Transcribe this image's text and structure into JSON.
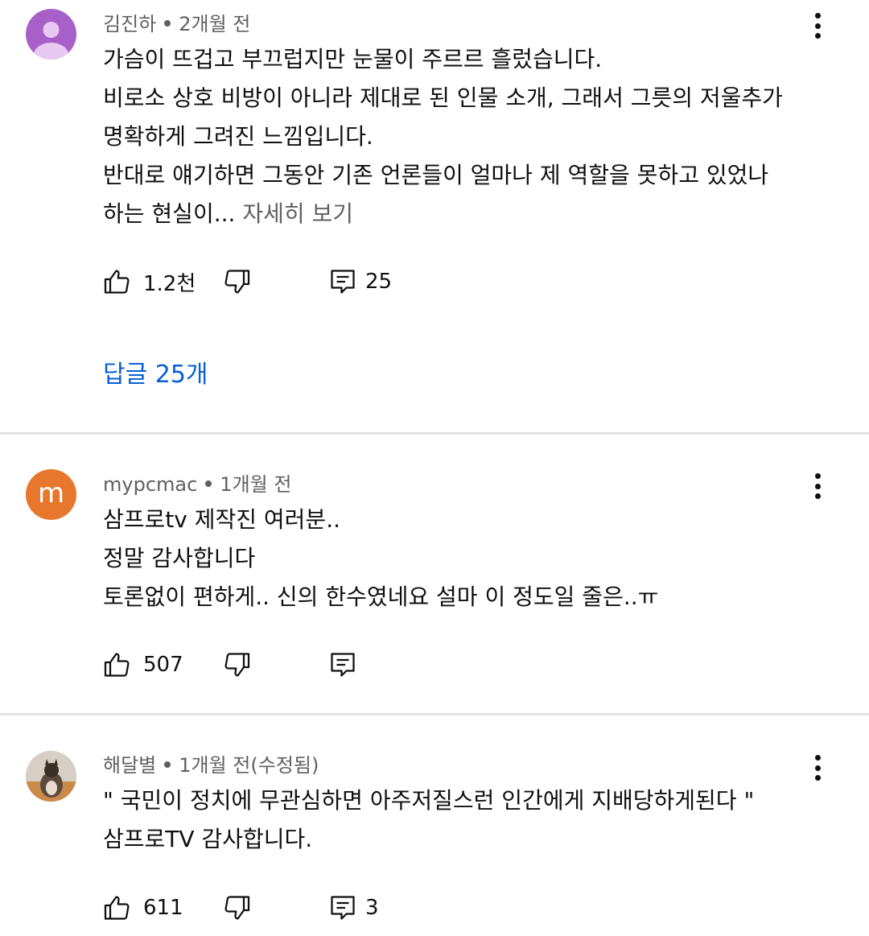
{
  "comments": [
    {
      "author": "김진하",
      "time": "2개월 전",
      "avatar_color": "#a860c9",
      "lines": [
        "가슴이 뜨겁고 부끄럽지만 눈물이 주르르 흘렀습니다.",
        "비로소 상호 비방이 아니라 제대로 된 인물 소개,  그래서 그릇의 저울추가",
        "명확하게 그려진 느낌입니다.",
        "반대로 얘기하면 그동안 기존 언론들이 얼마나 제 역할을 못하고 있었나",
        "하는 현실이..."
      ],
      "read_more": "자세히 보기",
      "likes": "1.2천",
      "reply_count": "25",
      "replies_link": "답글 25개"
    },
    {
      "author": "mypcmac",
      "time": "1개월 전",
      "avatar_letter": "m",
      "avatar_color": "#e8772e",
      "lines": [
        "삼프로tv 제작진 여러분..",
        "정말 감사합니다",
        "토론없이 편하게.. 신의 한수였네요 설마 이 정도일 줄은..ㅠ"
      ],
      "likes": "507",
      "reply_count": ""
    },
    {
      "author": "해달별",
      "time": "1개월 전(수정됨)",
      "avatar_color": "#8a7a6a",
      "lines": [
        "\" 국민이 정치에 무관심하면 아주저질스런 인간에게 지배당하게된다 \"",
        "삼프로TV 감사합니다."
      ],
      "likes": "611",
      "reply_count": "3"
    }
  ],
  "icons": {
    "like": "thumbs-up-icon",
    "dislike": "thumbs-down-icon",
    "reply": "comment-reply-icon",
    "more": "more-vertical-icon"
  }
}
